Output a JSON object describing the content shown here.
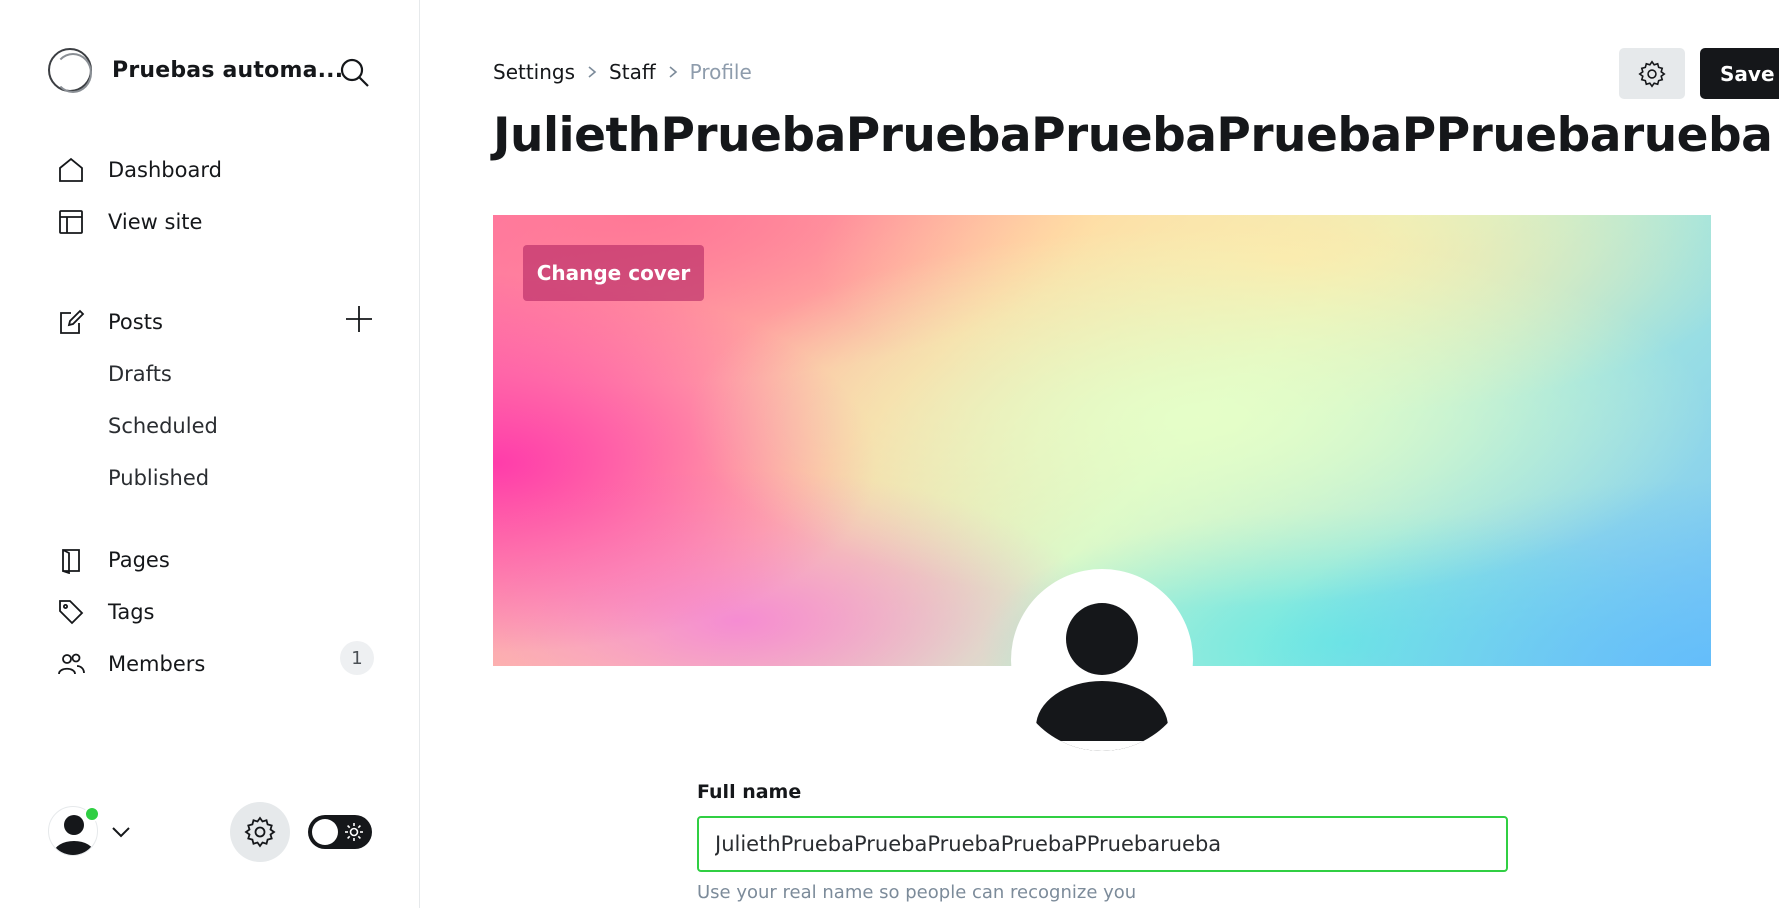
{
  "sidebar": {
    "site_title": "Pruebas automa...",
    "nav": {
      "dashboard": "Dashboard",
      "view_site": "View site",
      "posts": "Posts",
      "drafts": "Drafts",
      "scheduled": "Scheduled",
      "published": "Published",
      "pages": "Pages",
      "tags": "Tags",
      "members": "Members",
      "members_count": "1"
    },
    "online_color": "#30cf43"
  },
  "header": {
    "breadcrumb": [
      "Settings",
      "Staff",
      "Profile"
    ],
    "title": "JuliethPruebaPruebaPruebaPruebaPPruebarueba",
    "save_label": "Save"
  },
  "cover": {
    "change_label": "Change cover"
  },
  "form": {
    "full_name_label": "Full name",
    "full_name_value": "JuliethPruebaPruebaPruebaPruebaPPruebarueba",
    "full_name_help": "Use your real name so people can recognize you",
    "focus_color": "#30cf43"
  }
}
